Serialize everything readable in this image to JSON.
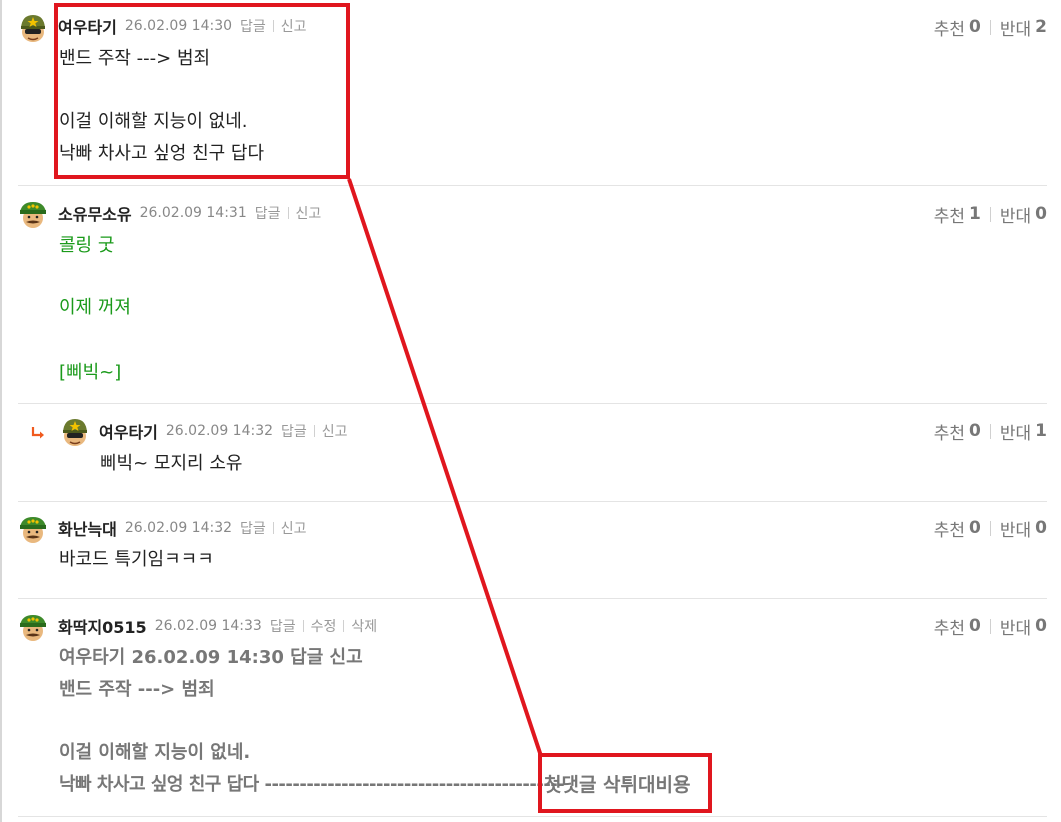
{
  "theme": {
    "accent_red": "#e0161e",
    "reply_arrow_color": "#f05a1e",
    "green_text": "#1a9a1a"
  },
  "comments": [
    {
      "nick": "여우타기",
      "date": "26.02.09 14:30",
      "actions": [
        "답글",
        "신고"
      ],
      "votes": {
        "up_label": "추천",
        "up": "0",
        "down_label": "반대",
        "down": "2"
      },
      "lines": [
        "밴드 주작 ---> 범죄",
        "",
        "이걸 이해할 지능이 없네.",
        "낙빠 차사고 싶엉 친구 답다"
      ],
      "avatar": "soldier-helmet-star-icon"
    },
    {
      "nick": "소유무소유",
      "date": "26.02.09 14:31",
      "actions": [
        "답글",
        "신고"
      ],
      "votes": {
        "up_label": "추천",
        "up": "1",
        "down_label": "반대",
        "down": "0"
      },
      "lines": [
        "콜링 굿",
        "",
        "이제 꺼져",
        "",
        "[삐빅~]"
      ],
      "avatar": "mustache-officer-icon"
    },
    {
      "nick": "여우타기",
      "date": "26.02.09 14:32",
      "actions": [
        "답글",
        "신고"
      ],
      "votes": {
        "up_label": "추천",
        "up": "0",
        "down_label": "반대",
        "down": "1"
      },
      "lines": [
        "삐빅~ 모지리 소유"
      ],
      "avatar": "soldier-helmet-star-icon",
      "is_reply": true
    },
    {
      "nick": "화난늑대",
      "date": "26.02.09 14:32",
      "actions": [
        "답글",
        "신고"
      ],
      "votes": {
        "up_label": "추천",
        "up": "0",
        "down_label": "반대",
        "down": "0"
      },
      "lines": [
        "바코드 특기임ㅋㅋㅋ"
      ],
      "avatar": "mustache-officer-icon"
    },
    {
      "nick": "화딱지0515",
      "date": "26.02.09 14:33",
      "actions": [
        "답글",
        "수정",
        "삭제"
      ],
      "votes": {
        "up_label": "추천",
        "up": "0",
        "down_label": "반대",
        "down": "0"
      },
      "lines": [
        "여우타기 26.02.09 14:30 답글 신고",
        "밴드 주작 ---> 범죄",
        "",
        "이걸 이해할 지능이 없네.",
        "낙빠 차사고 싶엉 친구 답다 -------------------------------------------"
      ],
      "highlight_text": "첫댓글 삭튀대비용",
      "avatar": "mustache-officer-icon"
    }
  ]
}
